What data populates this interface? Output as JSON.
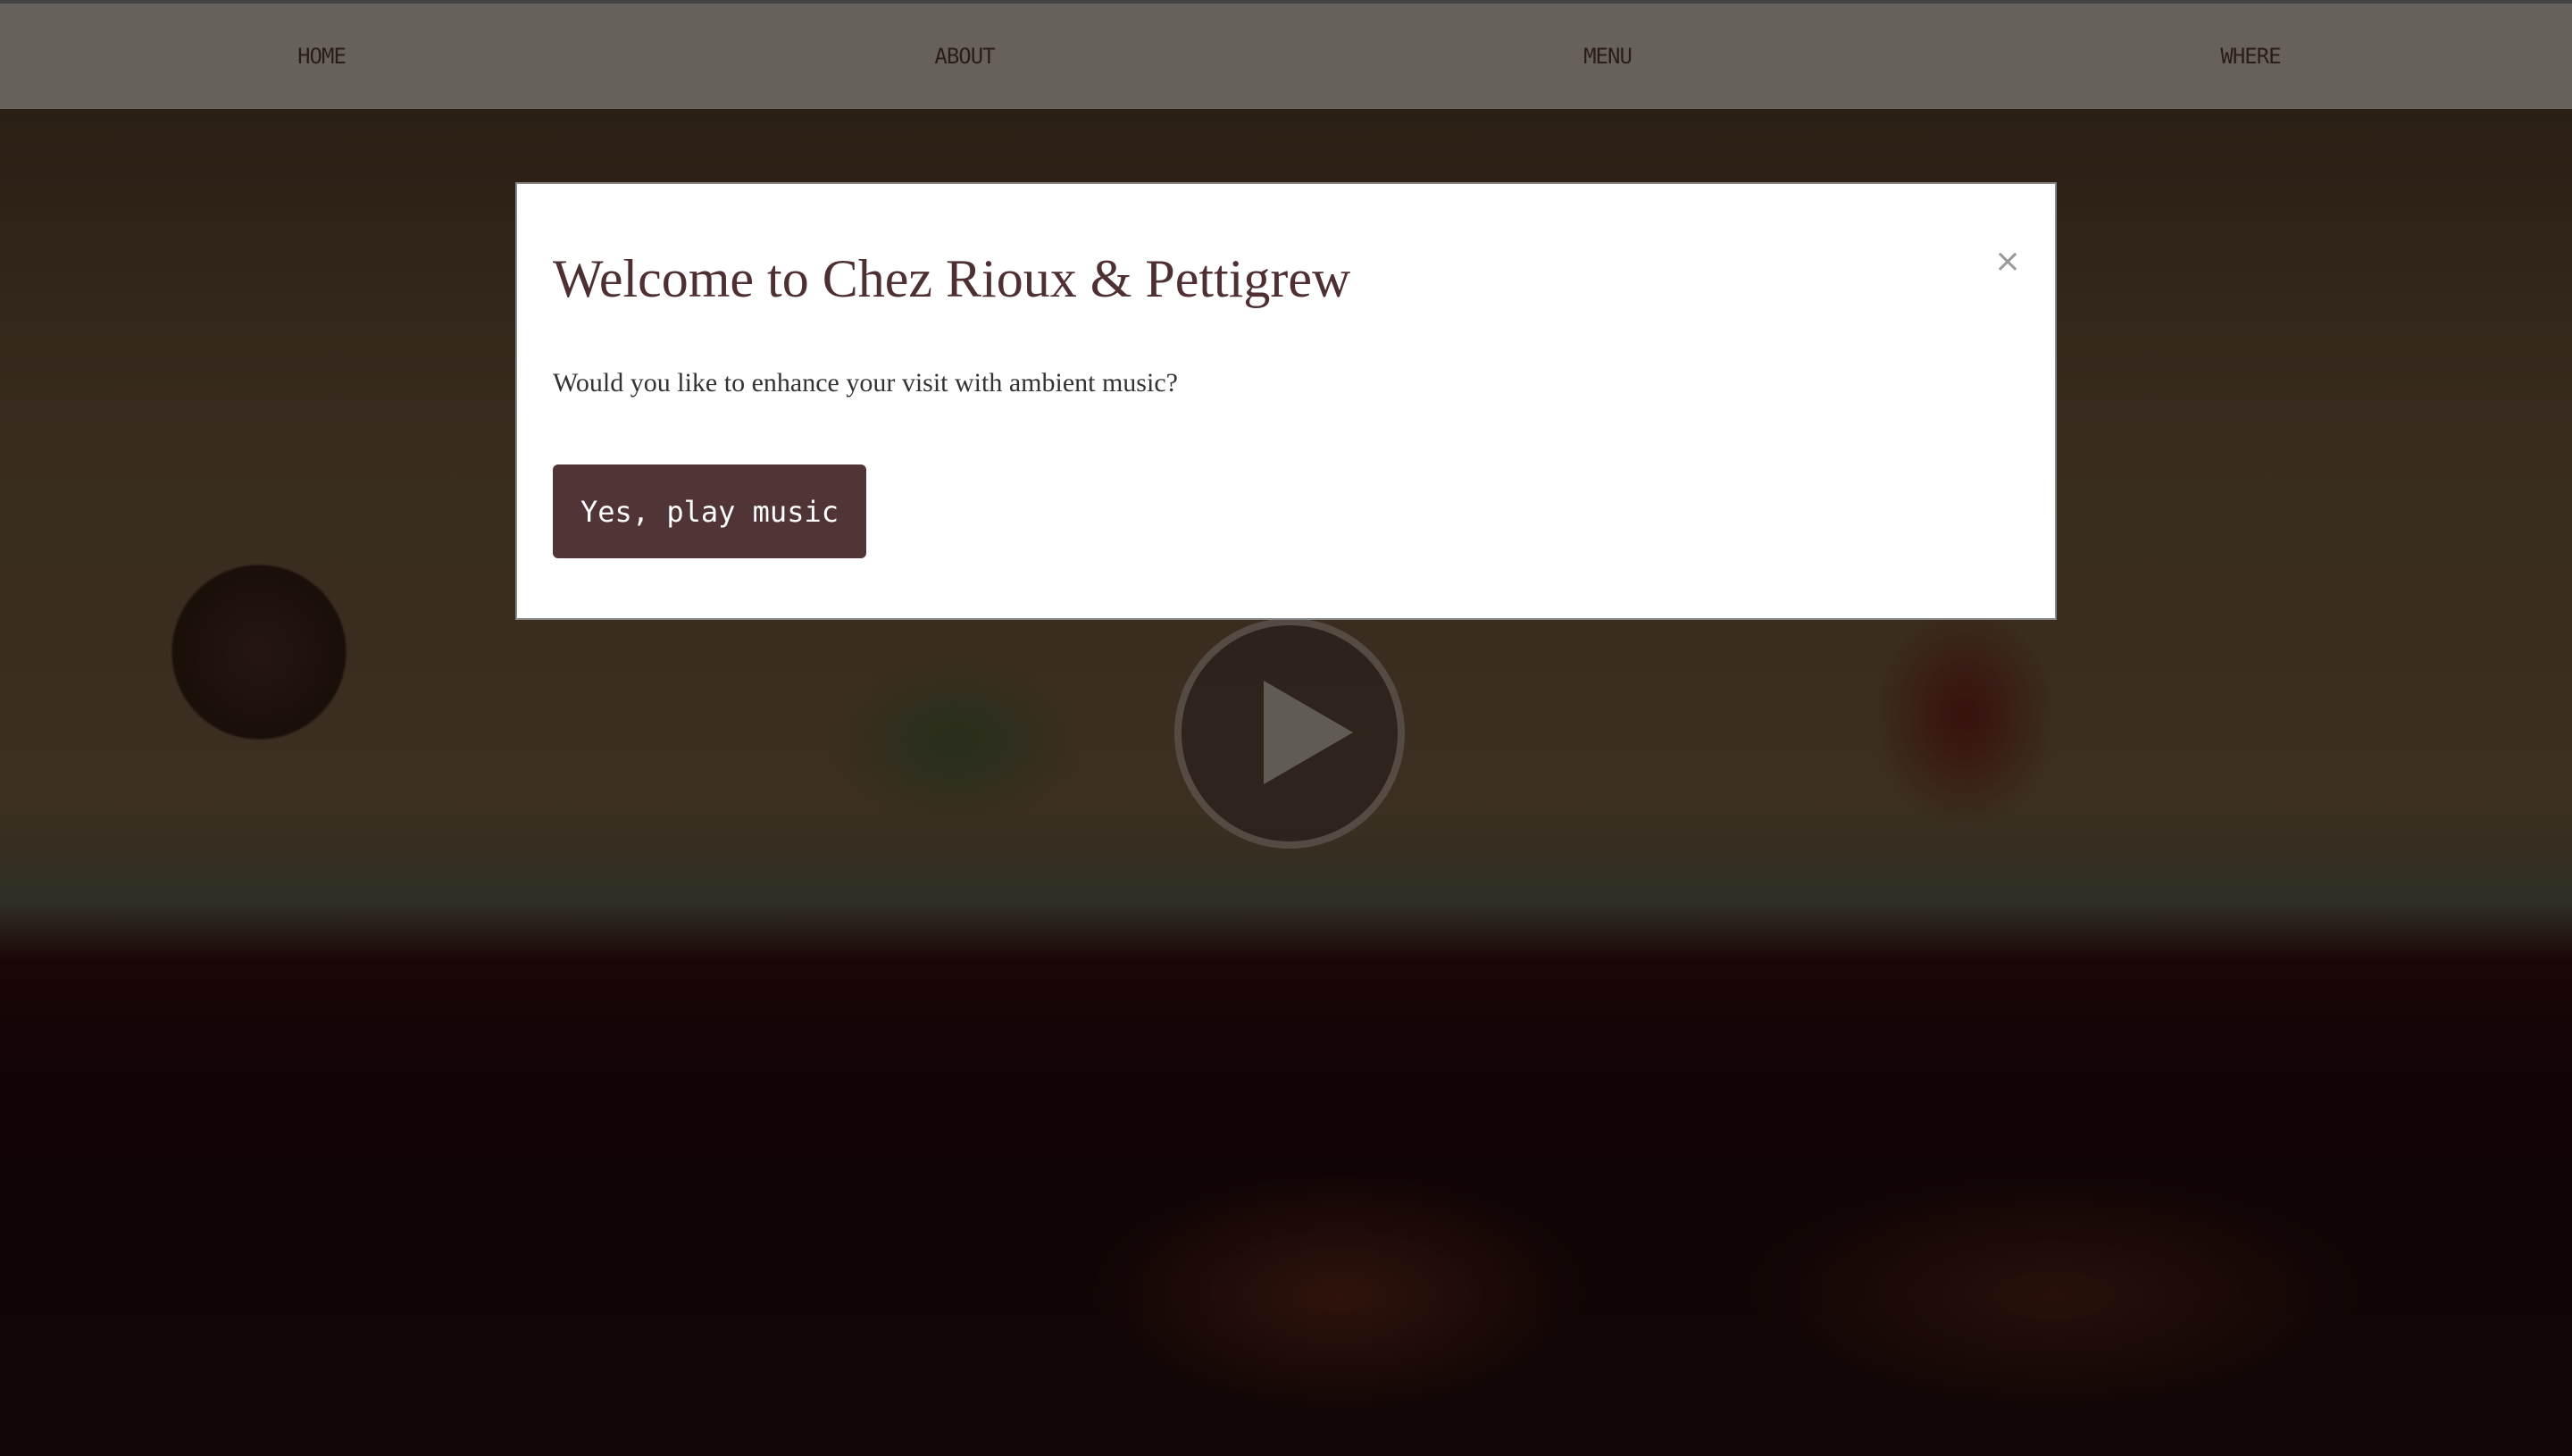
{
  "nav": {
    "items": [
      {
        "label": "HOME"
      },
      {
        "label": "ABOUT"
      },
      {
        "label": "MENU"
      },
      {
        "label": "WHERE"
      }
    ]
  },
  "modal": {
    "title": "Welcome to Chez Rioux & Pettigrew",
    "message": "Would you like to enhance your visit with ambient music?",
    "close_label": "×",
    "confirm_label": "Yes, play music"
  },
  "video": {
    "play_icon": "play-icon"
  },
  "colors": {
    "accent": "#513436",
    "nav_bg": "#66625b",
    "title": "#4e3032"
  }
}
